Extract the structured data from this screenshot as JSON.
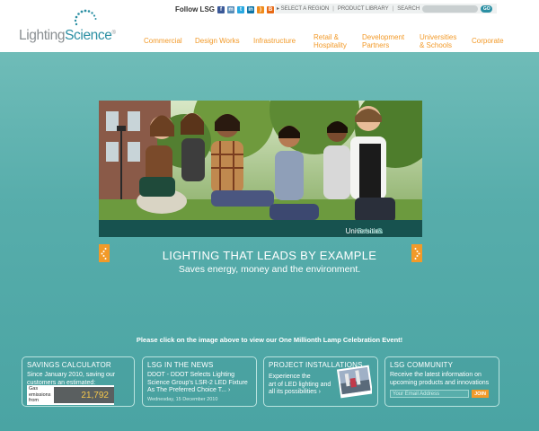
{
  "brand": {
    "logo_part1": "Lighting",
    "logo_part2": "Science",
    "logo_mark": "®",
    "accent": "#f29a29",
    "teal": "#2b8fa3"
  },
  "header": {
    "follow_label": "Follow LSG",
    "social_icons": [
      "facebook-icon",
      "myspace-icon",
      "twitter-icon",
      "linkedin-icon",
      "rss-icon",
      "blog-icon"
    ],
    "select_region": "▸ SELECT A REGION",
    "product_library": "PRODUCT LIBRARY",
    "search_label": "SEARCH",
    "go_label": "GO"
  },
  "nav": [
    {
      "label": "Commercial"
    },
    {
      "label": "Design Works"
    },
    {
      "label": "Infrastructure"
    },
    {
      "label": "Retail &",
      "label2": "Hospitality"
    },
    {
      "label": "Development",
      "label2": "Partners"
    },
    {
      "label": "Universities",
      "label2": "& Schools"
    },
    {
      "label": "Corporate"
    }
  ],
  "hero": {
    "caption_a": "Universities",
    "caption_amp": " & ",
    "caption_b": "Schools",
    "tagline": "LIGHTING THAT LEADS BY EXAMPLE",
    "subline": "Saves energy, money and the environment."
  },
  "event_text": "Please click on the image above to view our One Millionth Lamp Celebration Event!",
  "cards": {
    "calculator": {
      "title": "SAVINGS CALCULATOR",
      "body1": "Since January 2010, saving our",
      "body2": "customers an estimated:",
      "label1": "Gas",
      "label2": "emissions",
      "label3": "from",
      "value": "21,792"
    },
    "news": {
      "title": "LSG IN THE NEWS",
      "line1": "DDOT - DDOT Selects Lighting",
      "line2": "Science Group's LSR-2 LED Fixture",
      "line3": "As The Preferred Choice T... ›",
      "date": "Wednesday, 15 December 2010"
    },
    "projects": {
      "title": "PROJECT INSTALLATIONS",
      "line1": "Experience the",
      "line2": "art of LED lighting and",
      "line3": "all its possibilities ›"
    },
    "community": {
      "title": "LSG COMMUNITY",
      "line1": "Receive the latest information on",
      "line2": "upcoming products and innovations",
      "email_placeholder": "Your Email Address",
      "join_label": "JOIN"
    }
  }
}
